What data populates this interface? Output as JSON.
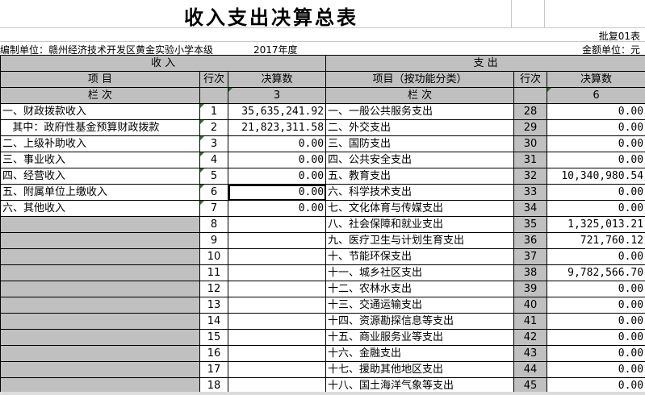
{
  "report": {
    "title": "收入支出决算总表",
    "form_code": "批复01表",
    "unit_label": "编制单位：赣州经济技术开发区黄金实验小学本级",
    "year": "2017年度",
    "currency_unit": "金额单位：元"
  },
  "headers": {
    "income_section": "收            入",
    "expense_section": "支            出",
    "item": "项      目",
    "row_no": "行次",
    "final_amount": "决算数",
    "expense_item": "项目（按功能分类）",
    "column": "栏      次",
    "income_col_no": "3",
    "expense_col_no": "6"
  },
  "rows": [
    {
      "income_item": "一、财政拨款收入",
      "income_row": "1",
      "income_amount": "35,635,241.92",
      "expense_item": "一、一般公共服务支出",
      "expense_row": "28",
      "expense_amount": "0.00"
    },
    {
      "income_item": "   其中：政府性基金预算财政拨款",
      "income_row": "2",
      "income_amount": "21,823,311.58",
      "expense_item": "二、外交支出",
      "expense_row": "29",
      "expense_amount": "0.00"
    },
    {
      "income_item": "二、上级补助收入",
      "income_row": "3",
      "income_amount": "0.00",
      "expense_item": "三、国防支出",
      "expense_row": "30",
      "expense_amount": "0.00"
    },
    {
      "income_item": "三、事业收入",
      "income_row": "4",
      "income_amount": "0.00",
      "expense_item": "四、公共安全支出",
      "expense_row": "31",
      "expense_amount": "0.00"
    },
    {
      "income_item": "四、经营收入",
      "income_row": "5",
      "income_amount": "0.00",
      "expense_item": "五、教育支出",
      "expense_row": "32",
      "expense_amount": "10,340,980.54"
    },
    {
      "income_item": "五、附属单位上缴收入",
      "income_row": "6",
      "income_amount": "0.00",
      "expense_item": "六、科学技术支出",
      "expense_row": "33",
      "expense_amount": "0.00"
    },
    {
      "income_item": "六、其他收入",
      "income_row": "7",
      "income_amount": "0.00",
      "expense_item": "七、文化体育与传媒支出",
      "expense_row": "34",
      "expense_amount": "0.00"
    },
    {
      "income_item": "",
      "income_row": "8",
      "income_amount": "",
      "expense_item": "八、社会保障和就业支出",
      "expense_row": "35",
      "expense_amount": "1,325,013.21"
    },
    {
      "income_item": "",
      "income_row": "9",
      "income_amount": "",
      "expense_item": "九、医疗卫生与计划生育支出",
      "expense_row": "36",
      "expense_amount": "721,760.12"
    },
    {
      "income_item": "",
      "income_row": "10",
      "income_amount": "",
      "expense_item": "十、节能环保支出",
      "expense_row": "37",
      "expense_amount": "0.00"
    },
    {
      "income_item": "",
      "income_row": "11",
      "income_amount": "",
      "expense_item": "十一、城乡社区支出",
      "expense_row": "38",
      "expense_amount": "9,782,566.70"
    },
    {
      "income_item": "",
      "income_row": "12",
      "income_amount": "",
      "expense_item": "十二、农林水支出",
      "expense_row": "39",
      "expense_amount": "0.00"
    },
    {
      "income_item": "",
      "income_row": "13",
      "income_amount": "",
      "expense_item": "十三、交通运输支出",
      "expense_row": "40",
      "expense_amount": "0.00"
    },
    {
      "income_item": "",
      "income_row": "14",
      "income_amount": "",
      "expense_item": "十四、资源勘探信息等支出",
      "expense_row": "41",
      "expense_amount": "0.00"
    },
    {
      "income_item": "",
      "income_row": "15",
      "income_amount": "",
      "expense_item": "十五、商业服务业等支出",
      "expense_row": "42",
      "expense_amount": "0.00"
    },
    {
      "income_item": "",
      "income_row": "16",
      "income_amount": "",
      "expense_item": "十六、金融支出",
      "expense_row": "43",
      "expense_amount": "0.00"
    },
    {
      "income_item": "",
      "income_row": "17",
      "income_amount": "",
      "expense_item": "十七、援助其他地区支出",
      "expense_row": "44",
      "expense_amount": "0.00"
    },
    {
      "income_item": "",
      "income_row": "18",
      "income_amount": "",
      "expense_item": "十八、国土海洋气象等支出",
      "expense_row": "45",
      "expense_amount": "0.00"
    }
  ],
  "colors": {
    "header_fill": "#c0c0c0",
    "indicator": "#1e7a1e",
    "grid": "#000000"
  }
}
